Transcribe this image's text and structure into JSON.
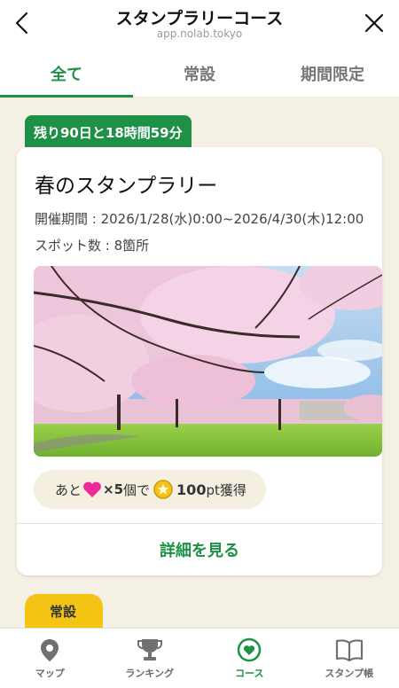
{
  "header": {
    "title": "スタンプラリーコース",
    "url": "app.nolab.tokyo"
  },
  "tabs": [
    {
      "label": "全て",
      "active": true
    },
    {
      "label": "常設",
      "active": false
    },
    {
      "label": "期間限定",
      "active": false
    }
  ],
  "course": {
    "remaining": "残り90日と18時間59分",
    "title": "春のスタンプラリー",
    "period": "開催期間 : 2026/1/28(水)0:00~2026/4/30(木)12:00",
    "spots": "スポット数 : 8箇所",
    "reward": {
      "prefix": "あと",
      "count": "×5",
      "unit_text": "個で",
      "points": "100",
      "suffix": "pt獲得"
    },
    "detail_label": "詳細を見る"
  },
  "next_section_badge": "常設",
  "bottom_nav": [
    {
      "label": "マップ",
      "icon": "map-pin-icon",
      "active": false
    },
    {
      "label": "ランキング",
      "icon": "trophy-icon",
      "active": false
    },
    {
      "label": "コース",
      "icon": "heart-circle-icon",
      "active": true
    },
    {
      "label": "スタンプ帳",
      "icon": "book-icon",
      "active": false
    }
  ],
  "colors": {
    "accent_green": "#1e9146",
    "badge_yellow": "#f3c413",
    "heart_pink": "#f0289a",
    "background": "#f5f0e4"
  }
}
